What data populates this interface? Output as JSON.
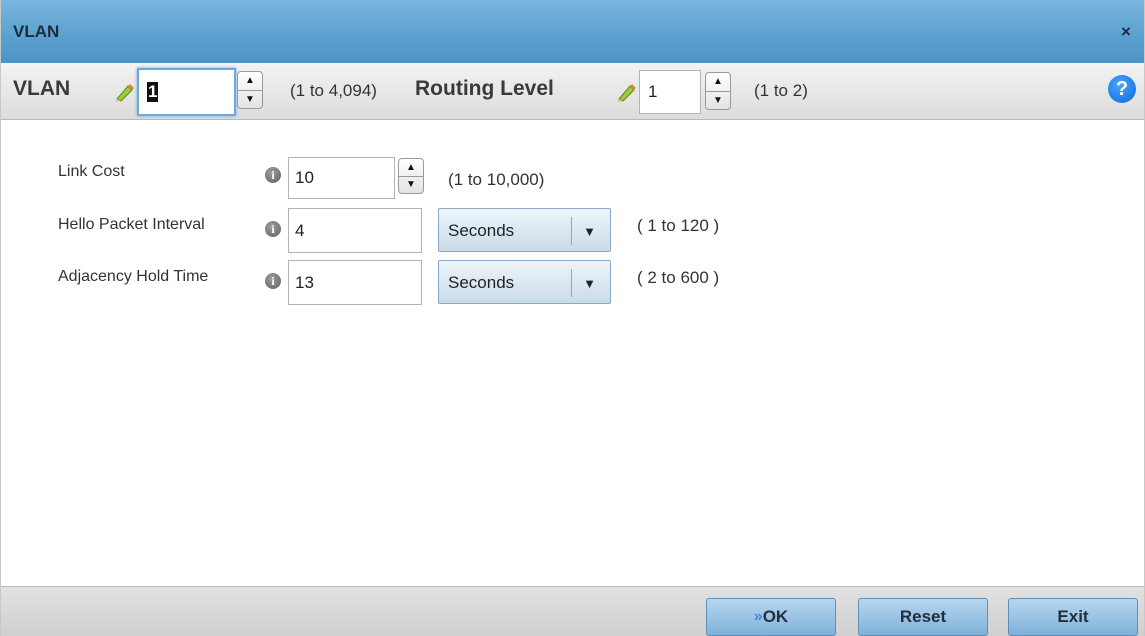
{
  "dialog": {
    "title": "VLAN",
    "close_glyph": "×"
  },
  "header": {
    "vlan_label": "VLAN",
    "vlan_value": "1",
    "vlan_range": "(1 to 4,094)",
    "routing_label": "Routing Level",
    "routing_value": "1",
    "routing_range": "(1 to 2)",
    "help_glyph": "?"
  },
  "fields": {
    "link_cost": {
      "label": "Link Cost",
      "value": "10",
      "range": "(1 to 10,000)"
    },
    "hello_interval": {
      "label": "Hello Packet Interval",
      "value": "4",
      "unit": "Seconds",
      "range": "( 1 to 120 )"
    },
    "hold_time": {
      "label": "Adjacency Hold Time",
      "value": "13",
      "unit": "Seconds",
      "range": "( 2 to 600 )"
    }
  },
  "footer": {
    "ok_label": "OK",
    "reset_label": "Reset",
    "exit_label": "Exit"
  },
  "icons": {
    "info": "i",
    "up": "▲",
    "down": "▼",
    "dropdown": "▼",
    "ok_arrows": "»"
  },
  "colors": {
    "titlebar": "#5aa0cf",
    "button": "#7fb1da",
    "help": "#0a6ad8"
  }
}
